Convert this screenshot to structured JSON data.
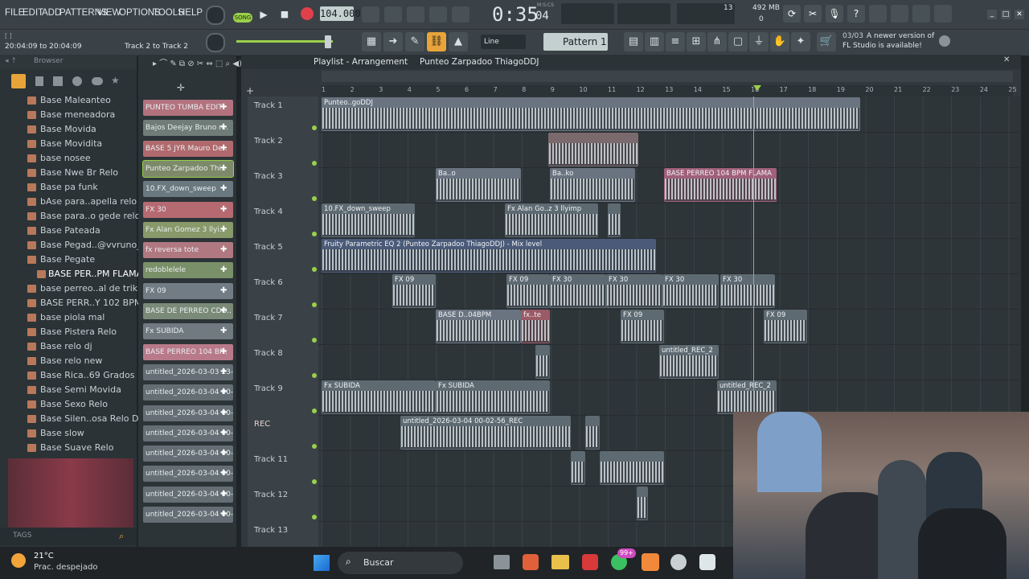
{
  "menu": {
    "items": [
      "FILE",
      "EDIT",
      "ADD",
      "PATTERNS",
      "VIEW",
      "OPTIONS",
      "TOOLS",
      "HELP"
    ]
  },
  "transport": {
    "mode": "SONG",
    "tempo": "104.000",
    "time": "0:35",
    "time_sub": "04",
    "time_unit": "M:S:CS"
  },
  "memory": {
    "cpu": "13",
    "ram": "492 MB",
    "poly": "0"
  },
  "hint": {
    "range": "20:04:09 to 20:04:09",
    "track_range": "Track 2 to Track 2"
  },
  "tool": {
    "snap": "Line",
    "pattern": "Pattern 1"
  },
  "update_notice": {
    "count": "03/03",
    "line1": "A newer version of",
    "line2": "FL Studio is available!"
  },
  "browser": {
    "title": "Browser",
    "tags_label": "TAGS",
    "items": [
      "Base Maleanteo",
      "Base meneadora",
      "Base Movida",
      "Base Movidita",
      "base nosee",
      "Base Nwe Br Relo",
      "Base pa funk",
      "bAse para..apella relo",
      "Base para..o gede relo",
      "Base Pateada",
      "Base Pegad..@vvruno_",
      "Base Pegate",
      "BASE PER..PM FLAMA",
      "base perreo..al de triki",
      "BASE PERR..Y 102 BPM",
      "base piola mal",
      "Base Pistera Relo",
      "Base relo dj",
      "Base relo new",
      "Base Rica..69 Grados",
      "Base Semi Movida",
      "Base Sexo Relo",
      "Base Silen..osa Relo Dj",
      "Base slow",
      "Base Suave Relo"
    ]
  },
  "channels": {
    "items": [
      {
        "label": "PUNTEO TUMBA EDIT",
        "color": "#b2727e"
      },
      {
        "label": "Bajos Deejay Bruno ri..",
        "color": "#6f7c78"
      },
      {
        "label": "BASE 5 JYR Mauro De..",
        "color": "#b06a6e"
      },
      {
        "label": "Punteo Zarpadoo Thi..",
        "color": "#7d8a6a"
      },
      {
        "label": "10.FX_down_sweep",
        "color": "#6a7880"
      },
      {
        "label": "FX 30",
        "color": "#b56a72"
      },
      {
        "label": "Fx Alan Gomez 3 llyi..",
        "color": "#88996a"
      },
      {
        "label": "fx reversa tote",
        "color": "#b07880"
      },
      {
        "label": "redoblelele",
        "color": "#7a9068"
      },
      {
        "label": "FX 09",
        "color": "#727c84"
      },
      {
        "label": "BASE DE PERREO CDO..",
        "color": "#7a8a78"
      },
      {
        "label": "Fx SUBIDA",
        "color": "#707a80"
      },
      {
        "label": "BASE PERREO 104 BP..",
        "color": "#b87a8a"
      },
      {
        "label": "untitled_2026-03-03 23-..",
        "color": "#646e74"
      },
      {
        "label": "untitled_2026-03-04 00-..",
        "color": "#646e74"
      },
      {
        "label": "untitled_2026-03-04 00-..",
        "color": "#646e74"
      },
      {
        "label": "untitled_2026-03-04 00-..",
        "color": "#646e74"
      },
      {
        "label": "untitled_2026-03-04 00-..",
        "color": "#646e74"
      },
      {
        "label": "untitled_2026-03-04 00-..",
        "color": "#646e74"
      },
      {
        "label": "untitled_2026-03-04 00-..",
        "color": "#646e74"
      },
      {
        "label": "untitled_2026-03-04 00-..",
        "color": "#646e74"
      }
    ]
  },
  "playlist": {
    "title": "Playlist - Arrangement",
    "pattern": "Punteo Zarpadoo ThiagoDDJ",
    "ruler": [
      "1",
      "2",
      "3",
      "4",
      "5",
      "6",
      "7",
      "8",
      "9",
      "10",
      "11",
      "12",
      "13",
      "14",
      "15",
      "16",
      "17",
      "18",
      "19",
      "20",
      "21",
      "22",
      "23",
      "24",
      "25"
    ],
    "tracks": [
      "Track 1",
      "Track 2",
      "Track 3",
      "Track 4",
      "Track 5",
      "Track 6",
      "Track 7",
      "Track 8",
      "Track 9",
      "REC",
      "Track 11",
      "Track 12",
      "Track 13"
    ],
    "clip_labels": {
      "t1": "Punteo..goDDJ",
      "t3a": "Ba..o",
      "t3b": "Ba..ko",
      "t3c": "BASE PERREO 104 BPM FLAMA",
      "t4a": "10.FX_down_sweep",
      "t4b": "Fx Alan Go..z 3 llyimp",
      "t5": "Fruity Parametric EQ 2 (Punteo Zarpadoo ThiagoDDJ) - Mix level",
      "t6a": "FX 09",
      "t6b": "FX 30",
      "t7a": "BASE D..04BPM",
      "t7b": "B..PM",
      "t7c": "fx..te",
      "t7d": "FX 09",
      "t8": "untitled_REC_2",
      "t9": "Fx SUBIDA",
      "t9b": "untitled_REC_2",
      "rec": "untitled_2026-03-04 00-02-56_REC"
    }
  },
  "taskbar": {
    "temp": "21°C",
    "weather": "Prac. despejado",
    "search": "Buscar",
    "badge": "99+"
  }
}
